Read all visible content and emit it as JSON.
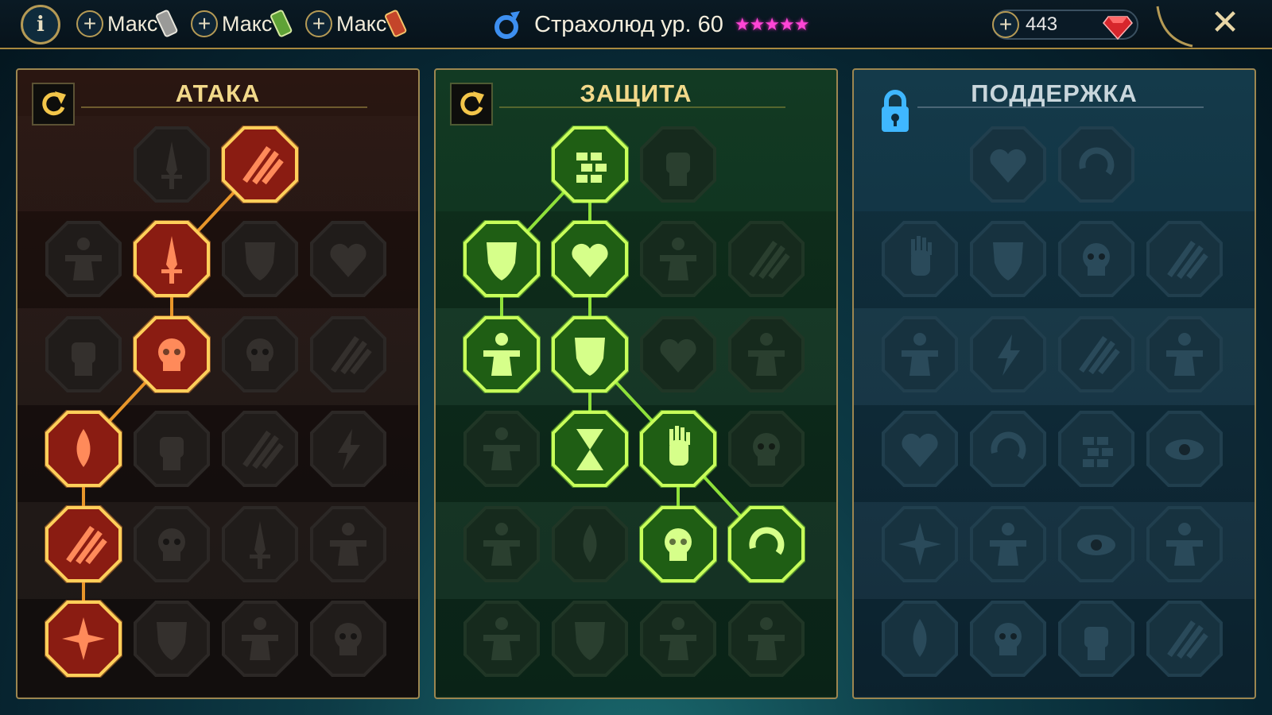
{
  "topbar": {
    "info_label": "i",
    "books": [
      {
        "label": "Макс",
        "icon": "grey-tome-icon"
      },
      {
        "label": "Макс",
        "icon": "green-tome-icon"
      },
      {
        "label": "Макс",
        "icon": "red-tome-icon"
      }
    ],
    "champion_title": "Страхолюд ур. 60",
    "stars": "★★★★★",
    "gem_count": "443",
    "close_label": "✕"
  },
  "panels": {
    "attack": {
      "title": "АТАКА",
      "accent": "#ff7a2a"
    },
    "defense": {
      "title": "ЗАЩИТА",
      "accent": "#8cff3a"
    },
    "support": {
      "title": "ПОДДЕРЖКА",
      "accent": "#4fc3ff",
      "locked": true
    }
  },
  "colors": {
    "gold": "#b59a55",
    "attack_active": "#c0391f",
    "defense_active": "#3aa51c",
    "stars": "#ff46d6"
  }
}
